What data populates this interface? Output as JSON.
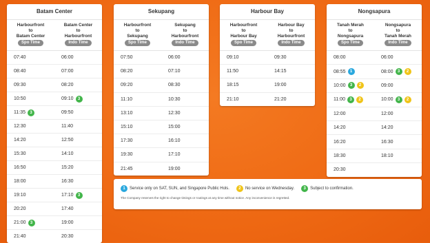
{
  "panels": [
    {
      "title": "Batam Center",
      "col1": {
        "line1": "Harbourfront",
        "line2": "to",
        "line3": "Batam Center",
        "pill": "Spo Time"
      },
      "col2": {
        "line1": "Batam Center",
        "line2": "to",
        "line3": "Harbourfront",
        "pill": "Indo Time"
      },
      "rows": [
        {
          "a": "07:40",
          "ab": [],
          "b": "06:00",
          "bb": []
        },
        {
          "a": "08:40",
          "ab": [],
          "b": "07:00",
          "bb": []
        },
        {
          "a": "09:30",
          "ab": [],
          "b": "08:20",
          "bb": []
        },
        {
          "a": "10:50",
          "ab": [],
          "b": "09:10",
          "bb": [
            "3"
          ]
        },
        {
          "a": "11:35",
          "ab": [
            "3"
          ],
          "b": "09:50",
          "bb": []
        },
        {
          "a": "12:30",
          "ab": [],
          "b": "11:40",
          "bb": []
        },
        {
          "a": "14:20",
          "ab": [],
          "b": "12:50",
          "bb": []
        },
        {
          "a": "15:30",
          "ab": [],
          "b": "14:10",
          "bb": []
        },
        {
          "a": "16:50",
          "ab": [],
          "b": "15:20",
          "bb": []
        },
        {
          "a": "18:00",
          "ab": [],
          "b": "16:30",
          "bb": []
        },
        {
          "a": "19:10",
          "ab": [],
          "b": "17:10",
          "bb": [
            "3"
          ]
        },
        {
          "a": "20:20",
          "ab": [],
          "b": "17:40",
          "bb": []
        },
        {
          "a": "21:00",
          "ab": [
            "3"
          ],
          "b": "19:00",
          "bb": []
        },
        {
          "a": "21:40",
          "ab": [],
          "b": "20:30",
          "bb": []
        }
      ]
    },
    {
      "title": "Sekupang",
      "col1": {
        "line1": "Harbourfront",
        "line2": "to",
        "line3": "Sekupang",
        "pill": "Spo Time"
      },
      "col2": {
        "line1": "Sekupang",
        "line2": "to",
        "line3": "Harbourfront",
        "pill": "Indo Time"
      },
      "rows": [
        {
          "a": "07:50",
          "ab": [],
          "b": "06:00",
          "bb": []
        },
        {
          "a": "08:20",
          "ab": [],
          "b": "07:10",
          "bb": []
        },
        {
          "a": "09:20",
          "ab": [],
          "b": "08:30",
          "bb": []
        },
        {
          "a": "11:10",
          "ab": [],
          "b": "10:30",
          "bb": []
        },
        {
          "a": "13:10",
          "ab": [],
          "b": "12:30",
          "bb": []
        },
        {
          "a": "15:10",
          "ab": [],
          "b": "15:00",
          "bb": []
        },
        {
          "a": "17:30",
          "ab": [],
          "b": "16:10",
          "bb": []
        },
        {
          "a": "19:30",
          "ab": [],
          "b": "17:10",
          "bb": []
        },
        {
          "a": "21:45",
          "ab": [],
          "b": "19:00",
          "bb": []
        }
      ]
    },
    {
      "title": "Harbour Bay",
      "col1": {
        "line1": "Harbourfront",
        "line2": "to",
        "line3": "Harbour Bay",
        "pill": "Spo Time"
      },
      "col2": {
        "line1": "Harbour Bay",
        "line2": "to",
        "line3": "Harbourfront",
        "pill": "Indo Time"
      },
      "rows": [
        {
          "a": "09:10",
          "ab": [],
          "b": "09:30",
          "bb": []
        },
        {
          "a": "11:50",
          "ab": [],
          "b": "14:15",
          "bb": []
        },
        {
          "a": "18:15",
          "ab": [],
          "b": "19:00",
          "bb": []
        },
        {
          "a": "21:10",
          "ab": [],
          "b": "21:20",
          "bb": []
        }
      ]
    },
    {
      "title": "Nongsapura",
      "col1": {
        "line1": "Tanah Merah",
        "line2": "to",
        "line3": "Nongsapura",
        "pill": "Spo Time"
      },
      "col2": {
        "line1": "Nongsapura",
        "line2": "to",
        "line3": "Tanah Merah",
        "pill": "Indo Time"
      },
      "rows": [
        {
          "a": "08:00",
          "ab": [],
          "b": "06:00",
          "bb": []
        },
        {
          "a": "08:55",
          "ab": [
            "1"
          ],
          "b": "08:00",
          "bb": [
            "3",
            "2"
          ]
        },
        {
          "a": "10:00",
          "ab": [
            "3",
            "2"
          ],
          "b": "09:00",
          "bb": []
        },
        {
          "a": "11:00",
          "ab": [
            "3",
            "2"
          ],
          "b": "10:00",
          "bb": [
            "3",
            "2"
          ]
        },
        {
          "a": "12:00",
          "ab": [],
          "b": "12:00",
          "bb": []
        },
        {
          "a": "14:20",
          "ab": [],
          "b": "14:20",
          "bb": []
        },
        {
          "a": "16:20",
          "ab": [],
          "b": "16:30",
          "bb": []
        },
        {
          "a": "18:30",
          "ab": [],
          "b": "18:10",
          "bb": []
        },
        {
          "a": "20:30",
          "ab": [],
          "b": "",
          "bb": []
        }
      ]
    }
  ],
  "legend": {
    "items": [
      {
        "badge": "1",
        "text": "Service only on SAT, SUN, and Singapore Public Hols."
      },
      {
        "badge": "2",
        "text": "No service on Wednesday."
      },
      {
        "badge": "3",
        "text": "Subject to confirmation."
      }
    ],
    "disclaimer": "The Company reserves the right to change timings or routings at any time without notice. Any inconvenience is regretted."
  },
  "colors": {
    "badge1": "#2aa8de",
    "badge2": "#f0c419",
    "badge3": "#42b54a",
    "background": "#ef6a14"
  }
}
